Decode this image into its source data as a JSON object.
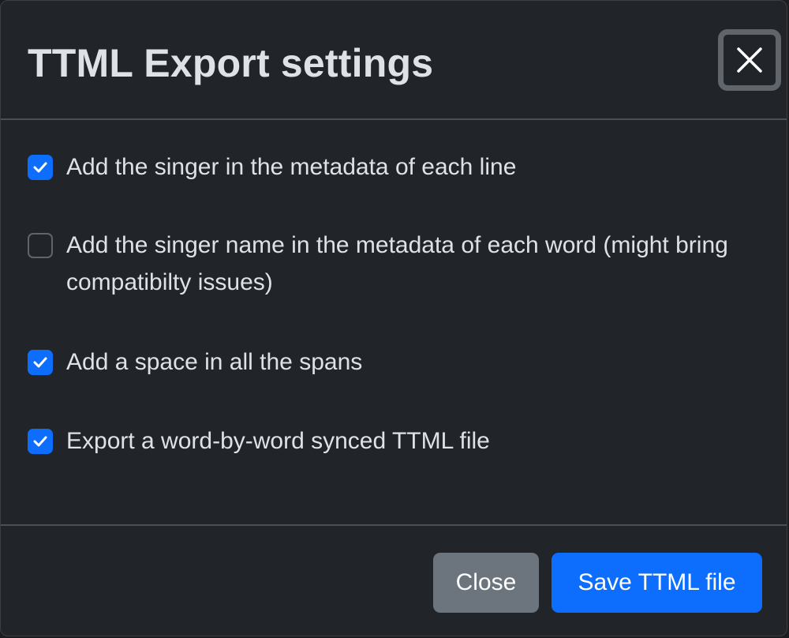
{
  "dialog": {
    "title": "TTML Export settings",
    "close_icon": "close-x-icon"
  },
  "options": [
    {
      "label": "Add the singer in the metadata of each line",
      "checked": true
    },
    {
      "label": "Add the singer name in the metadata of each word (might bring compatibilty issues)",
      "checked": false
    },
    {
      "label": "Add a space in all the spans",
      "checked": true
    },
    {
      "label": "Export a word-by-word synced TTML file",
      "checked": true
    }
  ],
  "footer": {
    "close_label": "Close",
    "save_label": "Save TTML file"
  },
  "colors": {
    "background": "#212529",
    "text": "#dee2e6",
    "primary": "#0d6efd",
    "secondary": "#6c757d",
    "divider": "#495057"
  }
}
